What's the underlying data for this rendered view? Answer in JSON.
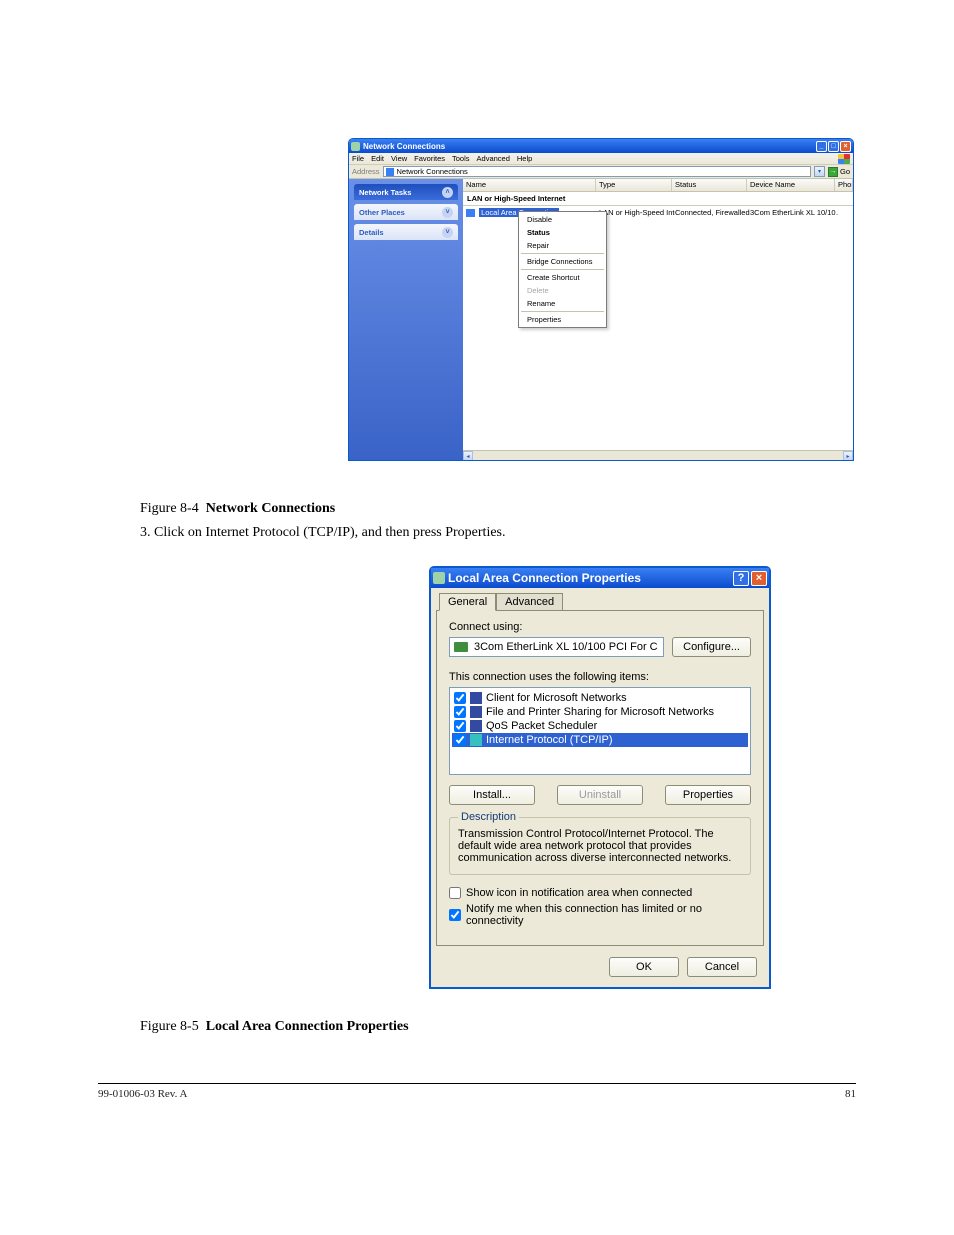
{
  "page": {
    "caption1_num": "Figure 8-4",
    "caption1_title": "Network Connections",
    "intro": "3. Click on Internet Protocol (TCP/IP), and then press Properties.",
    "caption2_num": "Figure 8-5",
    "caption2_title": "Local Area Connection Properties",
    "footer_left": "99-01006-03 Rev. A",
    "footer_right": "81"
  },
  "win1": {
    "title": "Network Connections",
    "menu": [
      "File",
      "Edit",
      "View",
      "Favorites",
      "Tools",
      "Advanced",
      "Help"
    ],
    "address_label": "Address",
    "address_value": "Network Connections",
    "go_label": "Go",
    "side": {
      "tasks": "Network Tasks",
      "other": "Other Places",
      "details": "Details"
    },
    "cols": {
      "name": "Name",
      "type": "Type",
      "status": "Status",
      "device": "Device Name",
      "phone": "Phone #"
    },
    "col_w": {
      "name": 133,
      "type": 76,
      "status": 75,
      "device": 88,
      "phone": 40
    },
    "group": "LAN or High-Speed Internet",
    "row": {
      "name": "Local Area Connection",
      "type": "LAN or High-Speed Inter…",
      "status": "Connected, Firewalled",
      "device": "3Com EtherLink XL 10/10…"
    },
    "ctx": {
      "disable": "Disable",
      "status": "Status",
      "repair": "Repair",
      "bridge": "Bridge Connections",
      "shortcut": "Create Shortcut",
      "delete": "Delete",
      "rename": "Rename",
      "properties": "Properties"
    }
  },
  "dlg": {
    "title": "Local Area Connection Properties",
    "tabs": {
      "general": "General",
      "advanced": "Advanced"
    },
    "connect_using": "Connect using:",
    "adapter": "3Com EtherLink XL 10/100 PCI For C",
    "configure": "Configure...",
    "uses": "This connection uses the following items:",
    "items": [
      "Client for Microsoft Networks",
      "File and Printer Sharing for Microsoft Networks",
      "QoS Packet Scheduler",
      "Internet Protocol (TCP/IP)"
    ],
    "install": "Install...",
    "uninstall": "Uninstall",
    "properties": "Properties",
    "desc_legend": "Description",
    "desc": "Transmission Control Protocol/Internet Protocol. The default wide area network protocol that provides communication across diverse interconnected networks.",
    "show_icon": "Show icon in notification area when connected",
    "notify": "Notify me when this connection has limited or no connectivity",
    "ok": "OK",
    "cancel": "Cancel"
  }
}
